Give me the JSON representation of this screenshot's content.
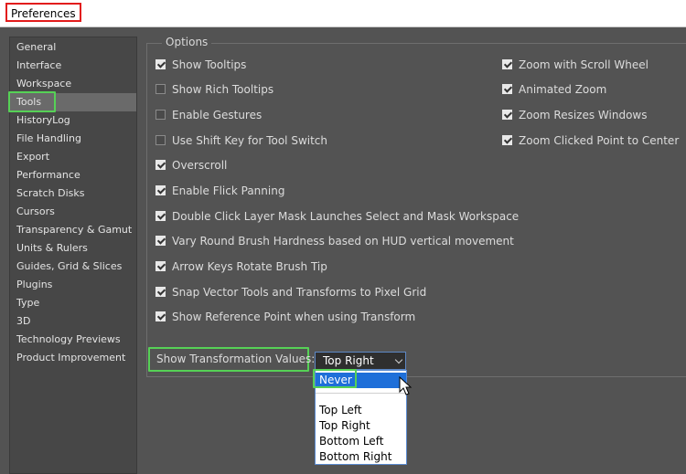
{
  "window": {
    "title": "Preferences"
  },
  "sidebar": {
    "items": [
      {
        "label": "General"
      },
      {
        "label": "Interface"
      },
      {
        "label": "Workspace"
      },
      {
        "label": "Tools"
      },
      {
        "label": "HistoryLog"
      },
      {
        "label": "File Handling"
      },
      {
        "label": "Export"
      },
      {
        "label": "Performance"
      },
      {
        "label": "Scratch Disks"
      },
      {
        "label": "Cursors"
      },
      {
        "label": "Transparency & Gamut"
      },
      {
        "label": "Units & Rulers"
      },
      {
        "label": "Guides, Grid & Slices"
      },
      {
        "label": "Plugins"
      },
      {
        "label": "Type"
      },
      {
        "label": "3D"
      },
      {
        "label": "Technology Previews"
      },
      {
        "label": "Product Improvement"
      }
    ],
    "selected": "Tools"
  },
  "options": {
    "legend": "Options",
    "left": [
      {
        "label": "Show Tooltips",
        "checked": true
      },
      {
        "label": "Show Rich Tooltips",
        "checked": false
      },
      {
        "label": "Enable Gestures",
        "checked": false
      },
      {
        "label": "Use Shift Key for Tool Switch",
        "checked": false
      },
      {
        "label": "Overscroll",
        "checked": true
      },
      {
        "label": "Enable Flick Panning",
        "checked": true
      },
      {
        "label": "Double Click Layer Mask Launches Select and Mask Workspace",
        "checked": true
      },
      {
        "label": "Vary Round Brush Hardness based on HUD vertical movement",
        "checked": true
      },
      {
        "label": "Arrow Keys Rotate Brush Tip",
        "checked": true
      },
      {
        "label": "Snap Vector Tools and Transforms to Pixel Grid",
        "checked": true
      },
      {
        "label": "Show Reference Point when using Transform",
        "checked": true
      }
    ],
    "right": [
      {
        "label": "Zoom with Scroll Wheel",
        "checked": true
      },
      {
        "label": "Animated Zoom",
        "checked": true
      },
      {
        "label": "Zoom Resizes Windows",
        "checked": true
      },
      {
        "label": "Zoom Clicked Point to Center",
        "checked": true
      }
    ]
  },
  "transformation": {
    "label": "Show Transformation Values:",
    "selected": "Top Right",
    "options": [
      "Never",
      "Top Left",
      "Top Right",
      "Bottom Left",
      "Bottom Right"
    ],
    "hovered": "Never"
  },
  "colors": {
    "highlight": "#56d156",
    "title_highlight": "#e21c1c",
    "hover": "#1e6fd9"
  }
}
